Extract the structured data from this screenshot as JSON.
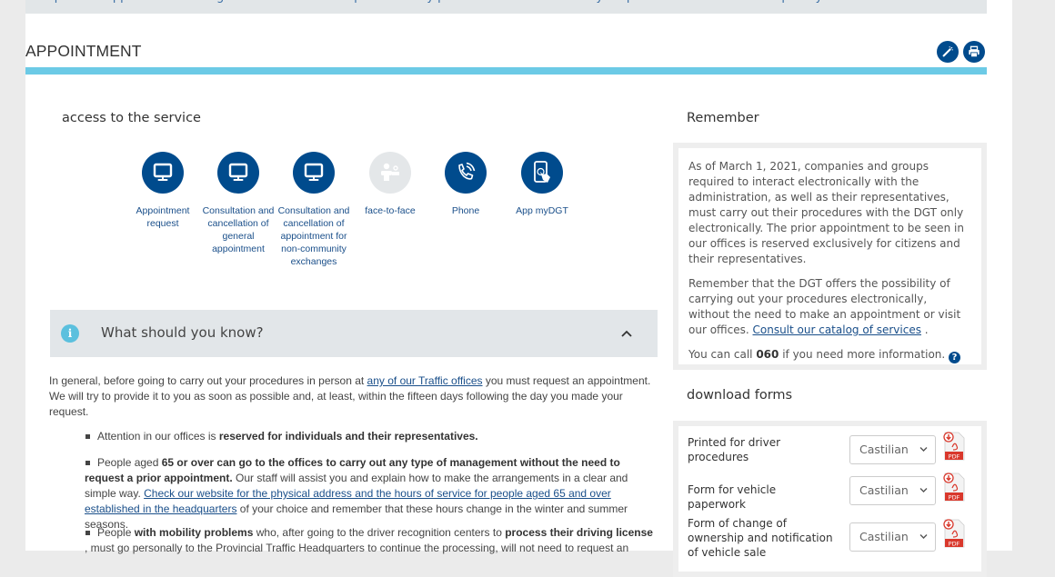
{
  "top_band_text": "request an appointment through the electronic headquarters or by phone. Call the number of your province and ask for the option you need",
  "page_title": "APPOINTMENT",
  "toolbar": {
    "easy_read_icon": "magic-wand-icon",
    "print_icon": "printer-icon"
  },
  "access": {
    "heading": "access to the service",
    "services": [
      {
        "label": "Appointment request",
        "icon": "monitor-icon",
        "enabled": true
      },
      {
        "label": "Consultation and cancellation of general appointment",
        "icon": "monitor-icon",
        "enabled": true
      },
      {
        "label": "Consultation and cancellation of appointment for non-community exchanges",
        "icon": "monitor-icon",
        "enabled": true
      },
      {
        "label": "face-to-face",
        "icon": "person-desk-icon",
        "enabled": false
      },
      {
        "label": "Phone",
        "icon": "phone-icon",
        "enabled": true
      },
      {
        "label": "App myDGT",
        "icon": "mobile-touch-icon",
        "enabled": true
      }
    ]
  },
  "accordion": {
    "title": "What should you know?",
    "expanded": true
  },
  "info": {
    "intro_pre": "In general, before going to carry out your procedures in person at ",
    "intro_link": "any of our Traffic offices",
    "intro_post": " you must request an appointment. We will try to provide it to you as soon as possible and, at least, within the fifteen days following the day you made your request.",
    "bullet1_pre": "Attention in our offices is ",
    "bullet1_bold": "reserved for individuals and their representatives.",
    "bullet2_pre": "People aged ",
    "bullet2_bold": "65 or over can go to the offices to carry out any type of management without the need to request a prior appointment.",
    "bullet2_mid": " Our staff will assist you and explain how to make the arrangements in a clear and simple way. ",
    "bullet2_link": "Check our website for the physical address and the hours of service for people aged 65 and over established in the headquarters",
    "bullet2_post": " of your choice and remember that these hours change in the winter and summer seasons.",
    "bullet3_pre": "People ",
    "bullet3_bold1": "with mobility problems",
    "bullet3_mid": " who, after going to the driver recognition centers to ",
    "bullet3_bold2": "process their driving license",
    "bullet3_post": " , must go personally to the Provincial Traffic Headquarters to continue the processing, will not need to request an"
  },
  "remember": {
    "heading": "Remember",
    "p1": "As of March 1, 2021, companies and groups required to interact electronically with the administration, as well as their representatives, must carry out their procedures with the DGT only electronically. The prior appointment to be seen in our offices is reserved exclusively for citizens and their representatives.",
    "p2_pre": "Remember that the DGT offers the possibility of carrying out your procedures electronically, without the need to make an appointment or visit our offices. ",
    "p2_link": "Consult our catalog of services",
    "p2_post": " .",
    "p3_pre": "You can call ",
    "p3_number": "060",
    "p3_post": " if you need more information. ",
    "help_icon": "question-circle-icon"
  },
  "forms": {
    "heading": "download forms",
    "items": [
      {
        "name": "Printed for driver procedures",
        "language": "Castilian",
        "icon": "pdf-download-icon"
      },
      {
        "name": "Form for vehicle paperwork",
        "language": "Castilian",
        "icon": "pdf-download-icon"
      },
      {
        "name": "Form of change of ownership and notification of vehicle sale",
        "language": "Castilian",
        "icon": "pdf-download-icon"
      }
    ]
  },
  "colors": {
    "brand_blue": "#004b8d",
    "accent_cyan": "#6ccae6",
    "link": "#1a4f8a",
    "panel_gray": "#e2e6e9",
    "pdf_red": "#d9382c"
  }
}
